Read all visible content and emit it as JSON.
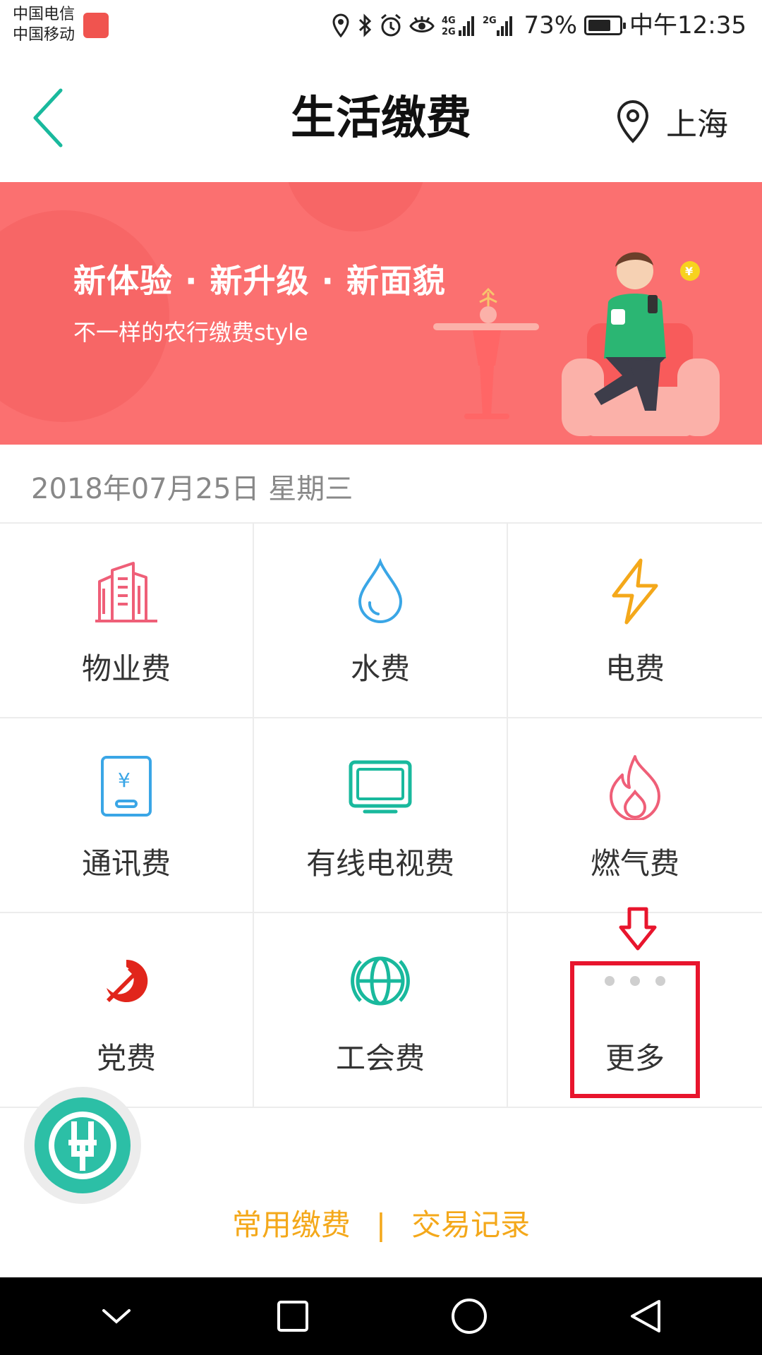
{
  "status_bar": {
    "carrier1": "中国电信",
    "carrier2": "中国移动",
    "network1": "4G",
    "network2": "2G",
    "battery_percent": "73%",
    "battery_level": 0.73,
    "time": "中午12:35"
  },
  "header": {
    "title": "生活缴费",
    "location": "上海",
    "accent_color": "#19b99d"
  },
  "banner": {
    "title": "新体验 · 新升级 · 新面貌",
    "subtitle": "不一样的农行缴费style",
    "coin_symbol": "¥",
    "background_color": "#fb7070"
  },
  "date": "2018年07月25日 星期三",
  "services": [
    {
      "label": "物业费",
      "icon": "building-icon",
      "color": "#ef5f78"
    },
    {
      "label": "水费",
      "icon": "water-drop-icon",
      "color": "#3aa6e6"
    },
    {
      "label": "电费",
      "icon": "lightning-icon",
      "color": "#f4a81a"
    },
    {
      "label": "通讯费",
      "icon": "phone-bill-icon",
      "color": "#3aa6e6",
      "symbol": "¥"
    },
    {
      "label": "有线电视费",
      "icon": "tv-icon",
      "color": "#19b99d"
    },
    {
      "label": "燃气费",
      "icon": "flame-icon",
      "color": "#ef5f78"
    },
    {
      "label": "党费",
      "icon": "hammer-sickle-icon",
      "color": "#e1251b"
    },
    {
      "label": "工会费",
      "icon": "union-icon",
      "color": "#19b99d"
    },
    {
      "label": "更多",
      "icon": "more-dots-icon",
      "color": "#cfcfcf"
    }
  ],
  "bottom_links": {
    "common": "常用缴费",
    "separator": "|",
    "records": "交易记录",
    "color": "#f4a81a"
  },
  "highlight_color": "#e8152d"
}
